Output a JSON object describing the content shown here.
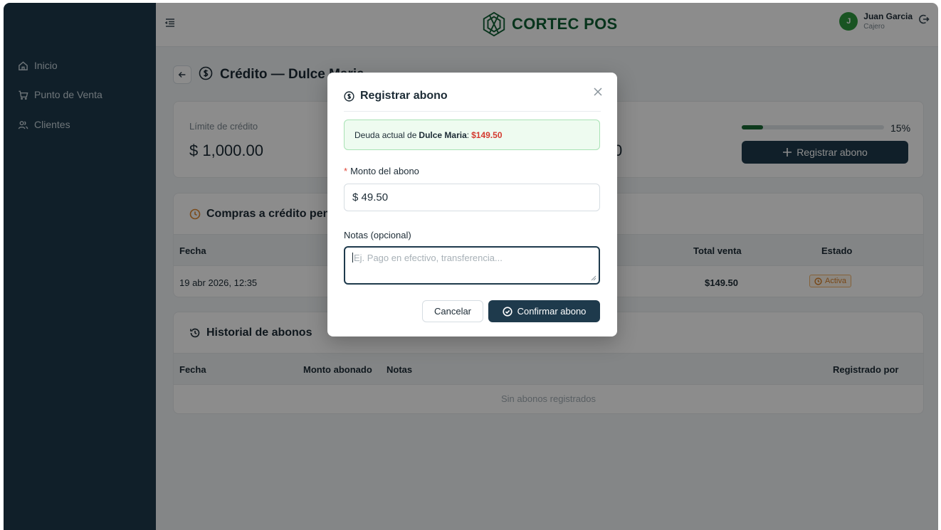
{
  "sidebar": {
    "items": [
      {
        "label": "Inicio",
        "icon": "home-icon"
      },
      {
        "label": "Punto de Venta",
        "icon": "cart-icon"
      },
      {
        "label": "Clientes",
        "icon": "users-icon"
      }
    ]
  },
  "header": {
    "logo_text": "CORTEC POS",
    "user_initial": "J",
    "user_name": "Juan Garcia",
    "user_role": "Cajero"
  },
  "page": {
    "title": "Crédito — Dulce Maria"
  },
  "summary": {
    "limit_label": "Límite de crédito",
    "limit_value": "$ 1,000.00",
    "other_value_tail": "0",
    "usage_percent": 15,
    "usage_label": "15%",
    "register_button": "Registrar abono"
  },
  "purchases": {
    "title": "Compras a crédito pendientes",
    "columns": [
      "Fecha",
      "Total venta",
      "Estado"
    ],
    "rows": [
      {
        "fecha": "19 abr 2026, 12:35",
        "total": "$149.50",
        "estado": "Activa"
      }
    ]
  },
  "history": {
    "title": "Historial de abonos",
    "columns": [
      "Fecha",
      "Monto abonado",
      "Notas",
      "Registrado por"
    ],
    "empty": "Sin abonos registrados"
  },
  "modal": {
    "title": "Registrar abono",
    "alert_prefix": "Deuda actual de",
    "alert_name": "Dulce Maria",
    "alert_colon": ":",
    "alert_amount": "$149.50",
    "amount_label": "Monto del abono",
    "amount_value": "$ 49.50",
    "notes_label": "Notas (opcional)",
    "notes_placeholder": "Ej. Pago en efectivo, transferencia...",
    "cancel_label": "Cancelar",
    "confirm_label": "Confirmar abono"
  },
  "colors": {
    "sidebar": "#1e3a4c",
    "primary": "#1e3a4c",
    "brand": "#0f5f34",
    "debt": "#d43a2f",
    "status_active": "#d9822b"
  }
}
